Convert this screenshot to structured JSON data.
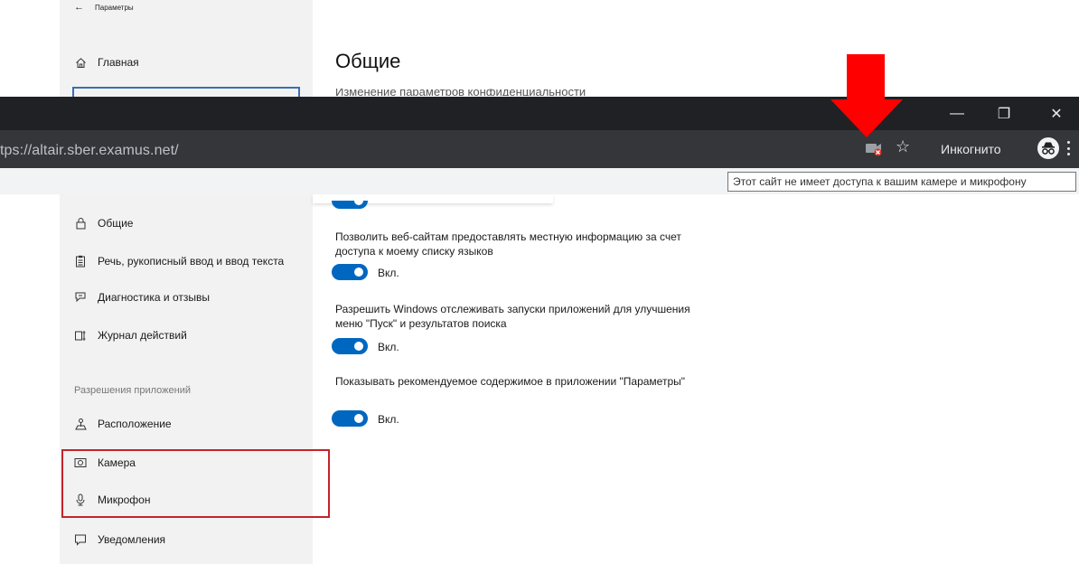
{
  "settings": {
    "window_title": "Параметры",
    "home_label": "Главная",
    "page_title": "Общие",
    "subtitle_peek": "Изменение параметров конфиденциальности",
    "sidebar": {
      "items": [
        {
          "label": "Общие",
          "icon": "lock-icon"
        },
        {
          "label": "Речь, рукописный ввод и ввод текста",
          "icon": "clipboard-icon"
        },
        {
          "label": "Диагностика и отзывы",
          "icon": "feedback-icon"
        },
        {
          "label": "Журнал действий",
          "icon": "timeline-icon"
        }
      ],
      "section_header": "Разрешения приложений",
      "permissions": [
        {
          "label": "Расположение",
          "icon": "location-icon"
        },
        {
          "label": "Камера",
          "icon": "camera-icon"
        },
        {
          "label": "Микрофон",
          "icon": "microphone-icon"
        },
        {
          "label": "Уведомления",
          "icon": "notification-icon"
        }
      ]
    },
    "options": [
      {
        "text": "Позволить веб-сайтам предоставлять местную информацию за счет доступа к моему списку языков",
        "state": "Вкл.",
        "on": true
      },
      {
        "text": "Разрешить Windows отслеживать запуски приложений для улучшения меню \"Пуск\" и результатов поиска",
        "state": "Вкл.",
        "on": true
      },
      {
        "text": "Показывать рекомендуемое содержимое в приложении \"Параметры\"",
        "state": "Вкл.",
        "on": true
      }
    ]
  },
  "browser": {
    "url": "tps://altair.sber.examus.net/",
    "incognito_label": "Инкогнито",
    "tooltip": "Этот сайт не имеет доступа к вашим камере и микрофону",
    "window_controls": {
      "minimize": "—",
      "maximize": "❐",
      "close": "✕"
    }
  },
  "colors": {
    "accent": "#0067c0",
    "browser_titlebar": "#202124",
    "browser_toolbar": "#35363a",
    "annotation_red": "#ff0000",
    "highlight_border": "#c4232a"
  }
}
